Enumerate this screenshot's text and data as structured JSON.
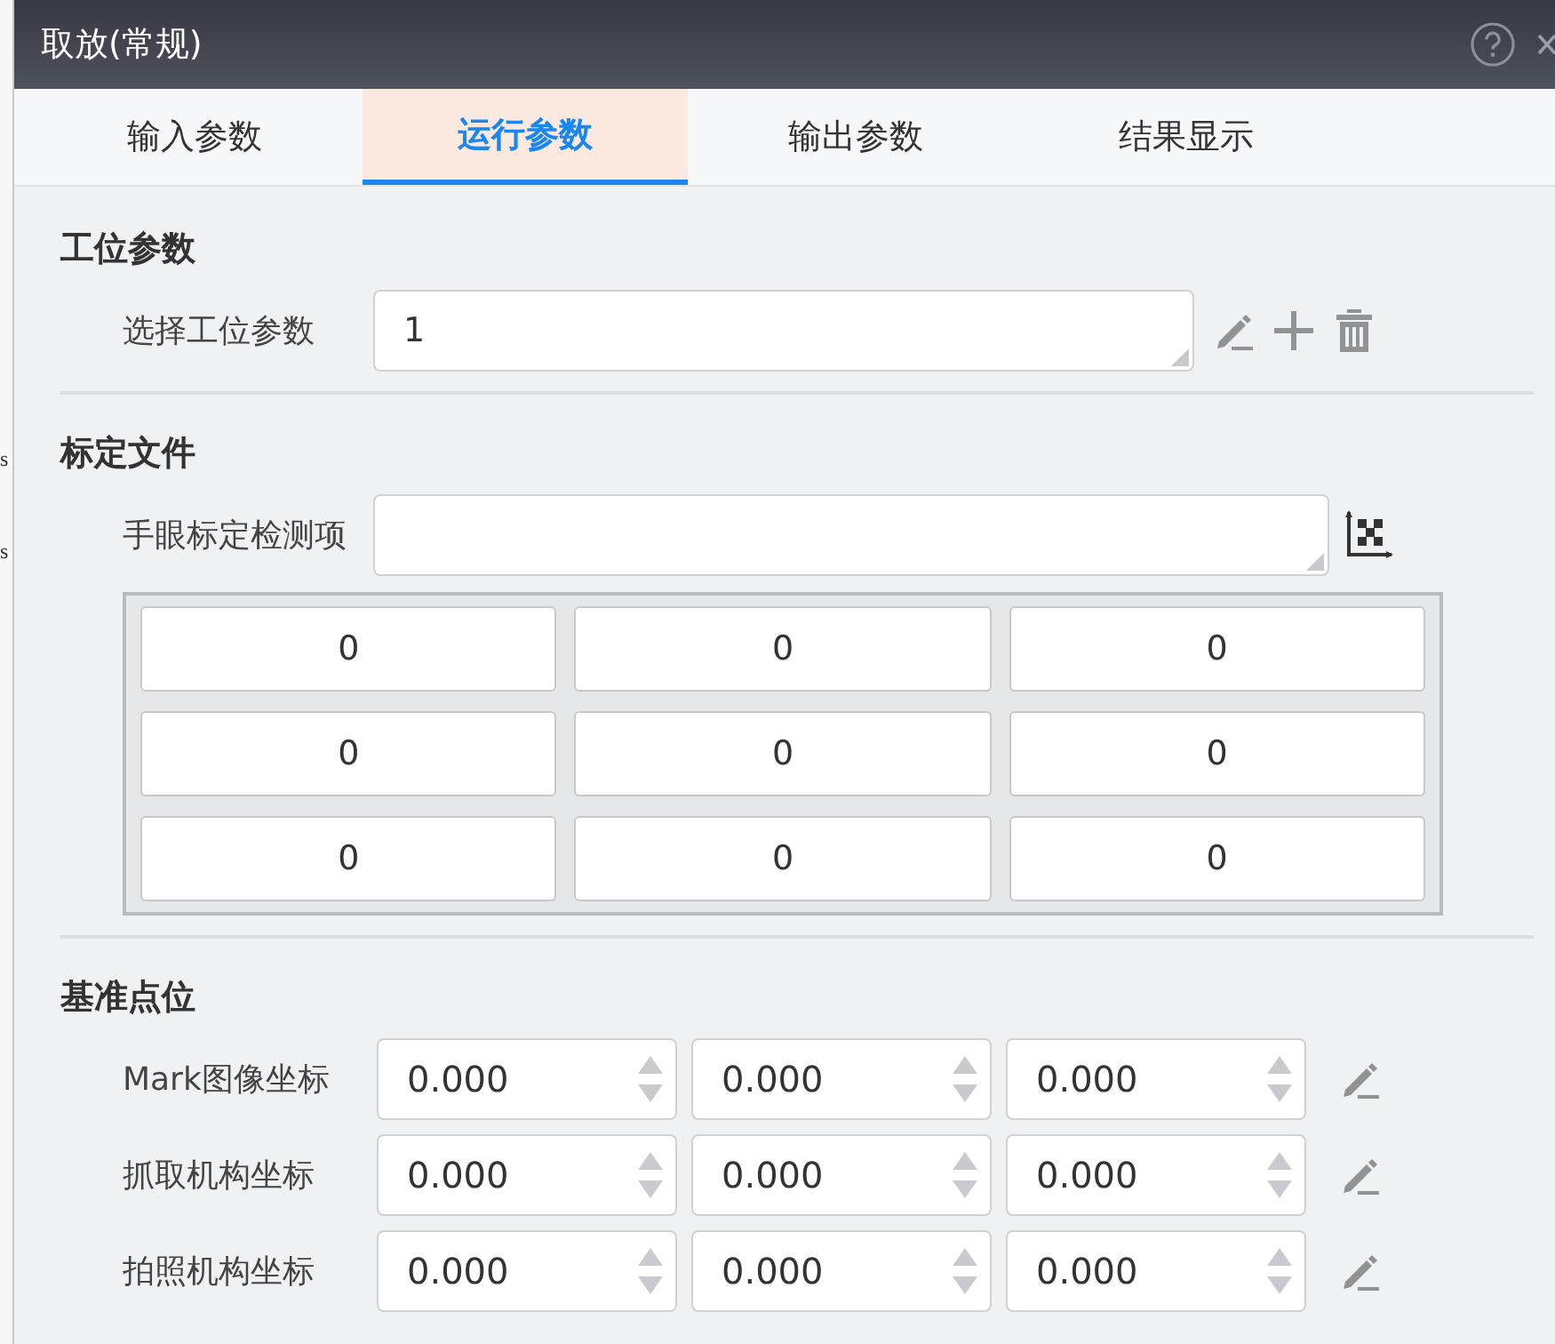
{
  "background": {
    "fragments": [
      "s",
      "s"
    ]
  },
  "window": {
    "title": "取放(常规)"
  },
  "tabs": [
    {
      "label": "输入参数",
      "selected": false
    },
    {
      "label": "运行参数",
      "selected": true
    },
    {
      "label": "输出参数",
      "selected": false
    },
    {
      "label": "结果显示",
      "selected": false
    }
  ],
  "sections": [
    {
      "kind": "station",
      "title": "工位参数",
      "label": "选择工位参数",
      "value": "1"
    },
    {
      "kind": "calibration",
      "title": "标定文件",
      "label": "手眼标定检测项",
      "matrix": [
        [
          "0",
          "0",
          "0"
        ],
        [
          "0",
          "0",
          "0"
        ],
        [
          "0",
          "0",
          "0"
        ]
      ]
    },
    {
      "kind": "points",
      "title": "基准点位",
      "rows": [
        {
          "label": "Mark图像坐标",
          "values": [
            "0.000",
            "0.000",
            "0.000"
          ]
        },
        {
          "label": "抓取机构坐标",
          "values": [
            "0.000",
            "0.000",
            "0.000"
          ]
        },
        {
          "label": "拍照机构坐标",
          "values": [
            "0.000",
            "0.000",
            "0.000"
          ]
        }
      ]
    }
  ]
}
